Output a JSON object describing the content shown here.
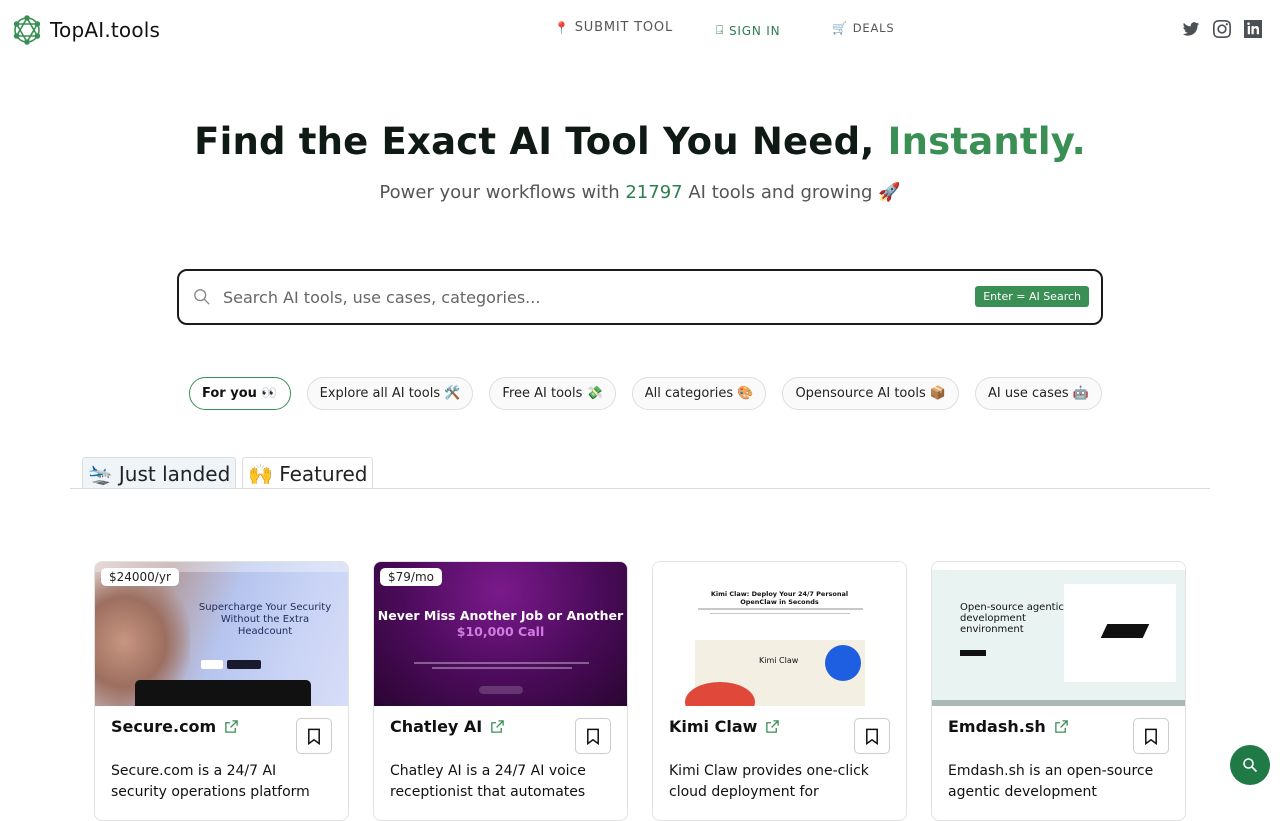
{
  "brand": {
    "name": "TopAI.tools",
    "accent_color": "#3a8f55"
  },
  "nav": {
    "submit": {
      "icon": "📍",
      "label": "SUBMIT TOOL"
    },
    "signin": {
      "icon": "⍈",
      "label": "SIGN IN"
    },
    "deals": {
      "icon": "🛒",
      "label": "DEALS"
    }
  },
  "socials": [
    "twitter-icon",
    "instagram-icon",
    "linkedin-icon"
  ],
  "hero": {
    "title_main": "Find the Exact AI Tool You Need, ",
    "title_accent": "Instantly.",
    "subtitle_prefix": "Power your workflows with ",
    "tool_count": "21797",
    "subtitle_suffix": " AI tools and growing ",
    "subtitle_emoji": "🚀"
  },
  "search": {
    "placeholder": "Search AI tools, use cases, categories...",
    "value": "",
    "hint": "Enter = AI Search"
  },
  "chips": [
    {
      "label": "For you 👀",
      "active": true
    },
    {
      "label": "Explore all AI tools 🛠️",
      "active": false
    },
    {
      "label": "Free AI tools 💸",
      "active": false
    },
    {
      "label": "All categories 🎨",
      "active": false
    },
    {
      "label": "Opensource AI tools 📦",
      "active": false
    },
    {
      "label": "AI use cases 🤖",
      "active": false
    }
  ],
  "tabs": [
    {
      "emoji": "🛬",
      "label": "Just landed",
      "active": true
    },
    {
      "emoji": "🙌",
      "label": "Featured",
      "active": false
    }
  ],
  "cards": [
    {
      "name": "Secure.com",
      "price": "$24000/yr",
      "thumb_headline": "Supercharge Your Security Without the Extra Headcount",
      "description": "Secure.com is a 24/7 AI security operations platform"
    },
    {
      "name": "Chatley AI",
      "price": "$79/mo",
      "thumb_headline": "Never Miss Another Job or Another",
      "thumb_money": "$10,000 Call",
      "description": "Chatley AI is a 24/7 AI voice receptionist that automates"
    },
    {
      "name": "Kimi Claw",
      "price": "",
      "thumb_headline": "Kimi Claw: Deploy Your 24/7 Personal OpenClaw in Seconds",
      "thumb_label": "Kimi Claw",
      "description": "Kimi Claw provides one-click cloud deployment for"
    },
    {
      "name": "Emdash.sh",
      "price": "",
      "thumb_headline": "Open-source agentic development environment",
      "description": "Emdash.sh is an open-source agentic development"
    }
  ]
}
